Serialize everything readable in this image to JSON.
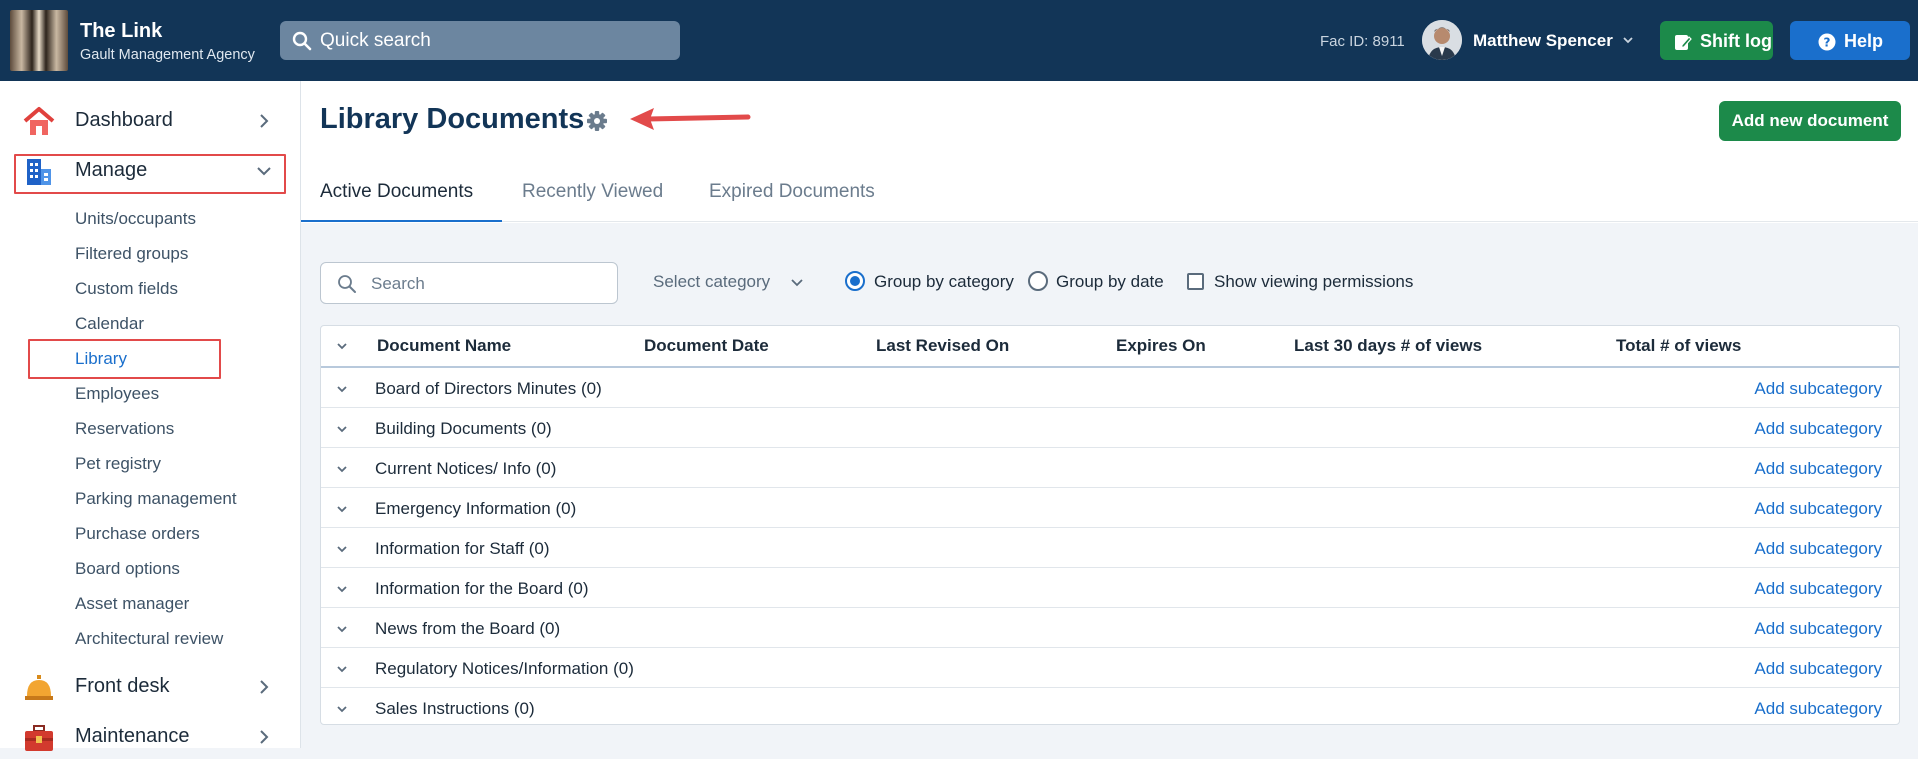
{
  "header": {
    "brand_title": "The Link",
    "brand_subtitle": "Gault Management Agency",
    "quick_search_label": "Quick search",
    "fac_id": "Fac ID: 8911",
    "user_name": "Matthew Spencer",
    "shift_log_label": "Shift log",
    "help_label": "Help"
  },
  "sidebar": {
    "main_items": [
      {
        "label": "Dashboard",
        "icon": "house-icon"
      },
      {
        "label": "Manage",
        "icon": "building-icon"
      },
      {
        "label": "Front desk",
        "icon": "bell-icon"
      },
      {
        "label": "Maintenance",
        "icon": "toolbox-icon"
      }
    ],
    "manage_subitems": [
      "Units/occupants",
      "Filtered groups",
      "Custom fields",
      "Calendar",
      "Library",
      "Employees",
      "Reservations",
      "Pet registry",
      "Parking management",
      "Purchase orders",
      "Board options",
      "Asset manager",
      "Architectural review"
    ],
    "active_subitem": "Library"
  },
  "page": {
    "title": "Library Documents",
    "add_button_label": "Add new document",
    "tabs": [
      "Active Documents",
      "Recently Viewed",
      "Expired Documents"
    ],
    "active_tab": "Active Documents"
  },
  "filters": {
    "search_placeholder": "Search",
    "category_select": "Select category",
    "group_by_category": "Group by category",
    "group_by_date": "Group by date",
    "show_permissions": "Show viewing permissions",
    "group_by_selected": "category",
    "show_permissions_checked": false
  },
  "table": {
    "columns": [
      "Document Name",
      "Document Date",
      "Last Revised On",
      "Expires On",
      "Last 30 days # of views",
      "Total # of views"
    ],
    "action_label": "Add subcategory",
    "rows": [
      "Board of Directors Minutes (0)",
      "Building Documents (0)",
      "Current Notices/ Info (0)",
      "Emergency Information (0)",
      "Information for Staff (0)",
      "Information for the Board (0)",
      "News from the Board (0)",
      "Regulatory Notices/Information (0)",
      "Sales Instructions (0)"
    ]
  },
  "colors": {
    "header_bg": "#123557",
    "accent_blue": "#1a6fcc",
    "accent_green": "#1c8a4a",
    "highlight_red": "#e24a4a"
  }
}
